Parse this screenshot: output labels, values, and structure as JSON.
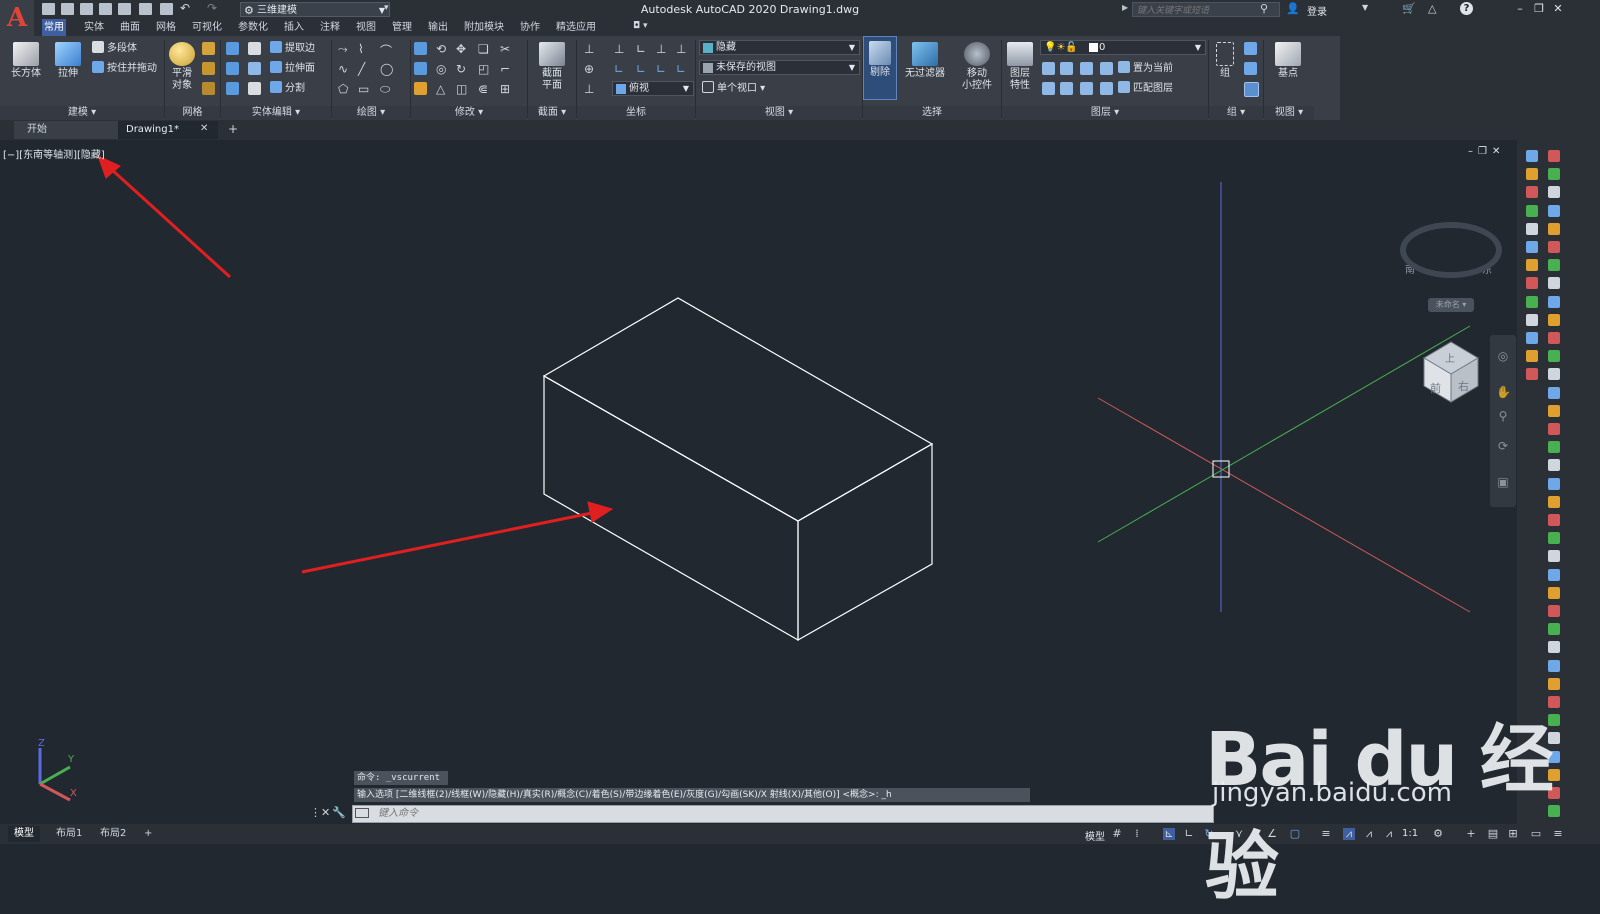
{
  "app": {
    "logo_letter": "A",
    "title": "Autodesk AutoCAD 2020    Drawing1.dwg",
    "workspace": "三维建模",
    "search_placeholder": "键入关键字或短语",
    "signin_label": "登录"
  },
  "ribbon_tabs": [
    {
      "label": "常用",
      "active": true
    },
    {
      "label": "实体"
    },
    {
      "label": "曲面"
    },
    {
      "label": "网格"
    },
    {
      "label": "可视化"
    },
    {
      "label": "参数化"
    },
    {
      "label": "插入"
    },
    {
      "label": "注释"
    },
    {
      "label": "视图"
    },
    {
      "label": "管理"
    },
    {
      "label": "输出"
    },
    {
      "label": "附加模块"
    },
    {
      "label": "协作"
    },
    {
      "label": "精选应用"
    }
  ],
  "ribbon": {
    "modeling": {
      "box": "长方体",
      "extrude": "拉伸",
      "polysolid": "多段体",
      "presspull": "按住并拖动",
      "footer": "建模 ▾"
    },
    "mesh": {
      "smooth_line1": "平滑",
      "smooth_line2": "对象",
      "footer": "网格"
    },
    "solid_edit": {
      "extract_edges": "提取边",
      "extrude_faces": "拉伸面",
      "separate": "分割",
      "footer": "实体编辑 ▾"
    },
    "draw": {
      "footer": "绘图 ▾"
    },
    "modify": {
      "footer": "修改 ▾"
    },
    "section": {
      "plane_line1": "截面",
      "plane_line2": "平面",
      "footer": "截面 ▾"
    },
    "coordinates": {
      "view_select": "俯视",
      "footer": "坐标"
    },
    "view": {
      "visual_style": "隐藏",
      "saved_view": "未保存的视图",
      "viewport": "单个视口",
      "footer": "视图 ▾"
    },
    "selection": {
      "cull": "剔除",
      "no_filter": "无过滤器",
      "gizmo_line1": "移动",
      "gizmo_line2": "小控件",
      "footer": "选择"
    },
    "layers": {
      "layer_props_line1": "图层",
      "layer_props_line2": "特性",
      "current_layer": "0",
      "make_current": "置为当前",
      "match_layer": "匹配图层",
      "footer": "图层 ▾"
    },
    "groups": {
      "group": "组",
      "footer": "组 ▾"
    },
    "view2": {
      "base": "基点",
      "footer": "视图 ▾"
    }
  },
  "doc_tabs": {
    "start": "开始",
    "drawing": "Drawing1*",
    "add": "+"
  },
  "viewport": {
    "label": "[−][东南等轴测][隐藏]",
    "cube_top": "上",
    "cube_front": "前",
    "cube_right": "右",
    "compass_south": "南",
    "compass_east": "东",
    "cube_menu": "未命名 ▾",
    "ucs_z": "Z",
    "ucs_y": "Y",
    "ucs_x": "X"
  },
  "command": {
    "history": "命令: _vscurrent",
    "prompt": "输入选项 [二维线框(2)/线框(W)/隐藏(H)/真实(R)/概念(C)/着色(S)/带边缘着色(E)/灰度(G)/勾画(SK)/X 射线(X)/其他(O)] <概念>: _h",
    "input_placeholder": "键入命令"
  },
  "layout_tabs": [
    {
      "label": "模型",
      "active": true
    },
    {
      "label": "布局1"
    },
    {
      "label": "布局2"
    },
    {
      "label": "+"
    }
  ],
  "status": {
    "model": "模型",
    "scale": "1:1"
  },
  "watermark": {
    "text": "Bai du 经验",
    "sub": "jingyan.baidu.com"
  },
  "icons": [
    "autocad-logo-icon",
    "new-icon",
    "open-icon",
    "save-icon",
    "undo-icon",
    "redo-icon",
    "gear-icon",
    "search-icon",
    "user-icon",
    "cart-icon",
    "help-icon",
    "minimize-icon",
    "restore-icon",
    "close-icon",
    "viewcube-icon",
    "ucs-icon",
    "pan-icon",
    "zoom-icon",
    "orbit-icon",
    "grid-icon",
    "snap-icon",
    "ortho-icon",
    "polar-icon"
  ],
  "colors": {
    "accent_tab": "#3f5fa0",
    "canvas_bg": "#212830",
    "x_axis": "#e06060",
    "y_axis": "#55c060",
    "z_axis": "#5a6de0",
    "arrow": "#e02020",
    "box_edges": "#ffffff"
  }
}
